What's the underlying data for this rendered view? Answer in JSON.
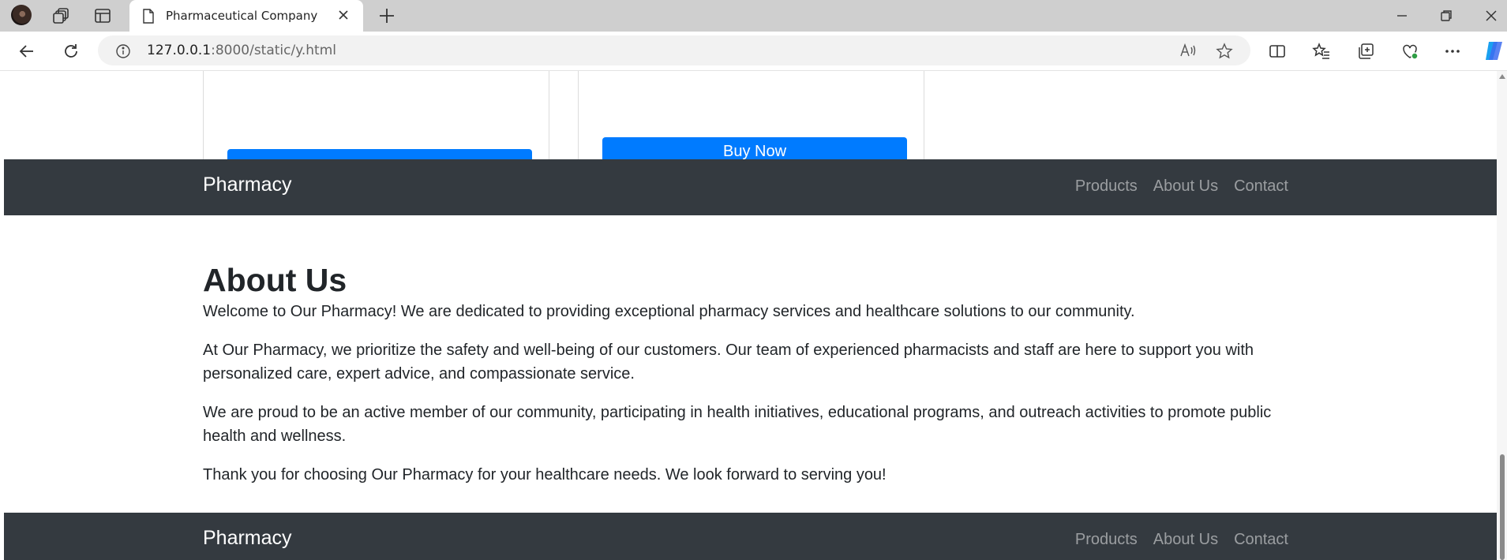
{
  "browser": {
    "tab_title": "Pharmaceutical Company",
    "url_host": "127.0.0.1",
    "url_path": ":8000/static/y.html"
  },
  "products": {
    "buy_label": "Buy Now"
  },
  "navbar": {
    "brand": "Pharmacy",
    "links": [
      "Products",
      "About Us",
      "Contact"
    ]
  },
  "about": {
    "heading": "About Us",
    "paragraphs": [
      "Welcome to Our Pharmacy! We are dedicated to providing exceptional pharmacy services and healthcare solutions to our community.",
      "At Our Pharmacy, we prioritize the safety and well-being of our customers. Our team of experienced pharmacists and staff are here to support you with personalized care, expert advice, and compassionate service.",
      "We are proud to be an active member of our community, participating in health initiatives, educational programs, and outreach activities to promote public health and wellness.",
      "Thank you for choosing Our Pharmacy for your healthcare needs. We look forward to serving you!"
    ]
  },
  "footer": {
    "brand": "Pharmacy",
    "links": [
      "Products",
      "About Us",
      "Contact"
    ]
  },
  "colors": {
    "primary": "#007bff",
    "navbar_bg": "#343a40",
    "text": "#212529"
  }
}
